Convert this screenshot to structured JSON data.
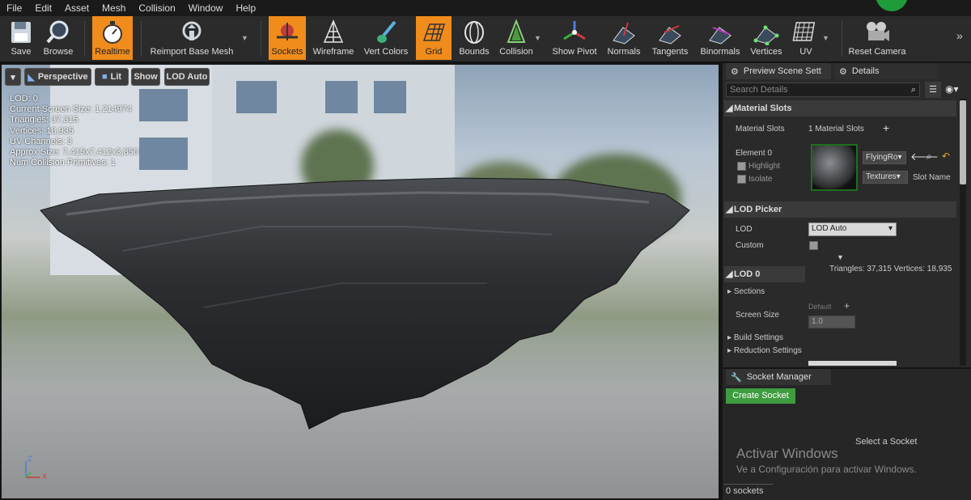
{
  "menu": [
    "File",
    "Edit",
    "Asset",
    "Mesh",
    "Collision",
    "Window",
    "Help"
  ],
  "toolbar": {
    "save": "Save",
    "browse": "Browse",
    "realtime": "Realtime",
    "reimport": "Reimport Base Mesh",
    "sockets": "Sockets",
    "wireframe": "Wireframe",
    "vert_colors": "Vert Colors",
    "grid": "Grid",
    "bounds": "Bounds",
    "collision": "Collision",
    "show_pivot": "Show Pivot",
    "normals": "Normals",
    "tangents": "Tangents",
    "binormals": "Binormals",
    "vertices": "Vertices",
    "uv": "UV",
    "reset_camera": "Reset Camera"
  },
  "viewport": {
    "perspective": "Perspective",
    "lit": "Lit",
    "show": "Show",
    "lod_auto": "LOD Auto",
    "stats": [
      "LOD:  0",
      "Current Screen Size:  1.214974",
      "Triangles:  37,315",
      "Vertices:  18,935",
      "UV Channels:  3",
      "Approx Size: 7,415x7,412x3,850",
      "Num Collision Primitives:  1"
    ],
    "axis_x": "X",
    "axis_z": "Z"
  },
  "tabs": {
    "preview_scene": "Preview Scene Sett",
    "details": "Details"
  },
  "details": {
    "search_placeholder": "Search Details",
    "material_slots_header": "Material Slots",
    "material_slots_label": "Material Slots",
    "material_slots_count": "1 Material Slots",
    "element0": "Element 0",
    "highlight": "Highlight",
    "isolate": "Isolate",
    "material_name": "FlyingRo",
    "textures": "Textures",
    "slot_name": "Slot Name",
    "lod_picker_header": "LOD Picker",
    "lod_label": "LOD",
    "lod_value": "LOD Auto",
    "custom_label": "Custom",
    "lod_stats": "Triangles: 37,315    Vertices: 18,935",
    "lod0_header": "LOD 0",
    "sections": "Sections",
    "screen_size": "Screen Size",
    "default_label": "Default",
    "screen_size_value": "1.0",
    "build_settings": "Build Settings",
    "reduction_settings": "Reduction Settings"
  },
  "socket_manager": {
    "tab": "Socket Manager",
    "create": "Create Socket",
    "select": "Select a Socket",
    "watermark1": "Activar Windows",
    "watermark2": "Ve a Configuración para activar Windows.",
    "count": "0 sockets"
  },
  "colors": {
    "accent": "#f08c1c",
    "green": "#3e9b3e",
    "panel": "#2a2a2a"
  }
}
